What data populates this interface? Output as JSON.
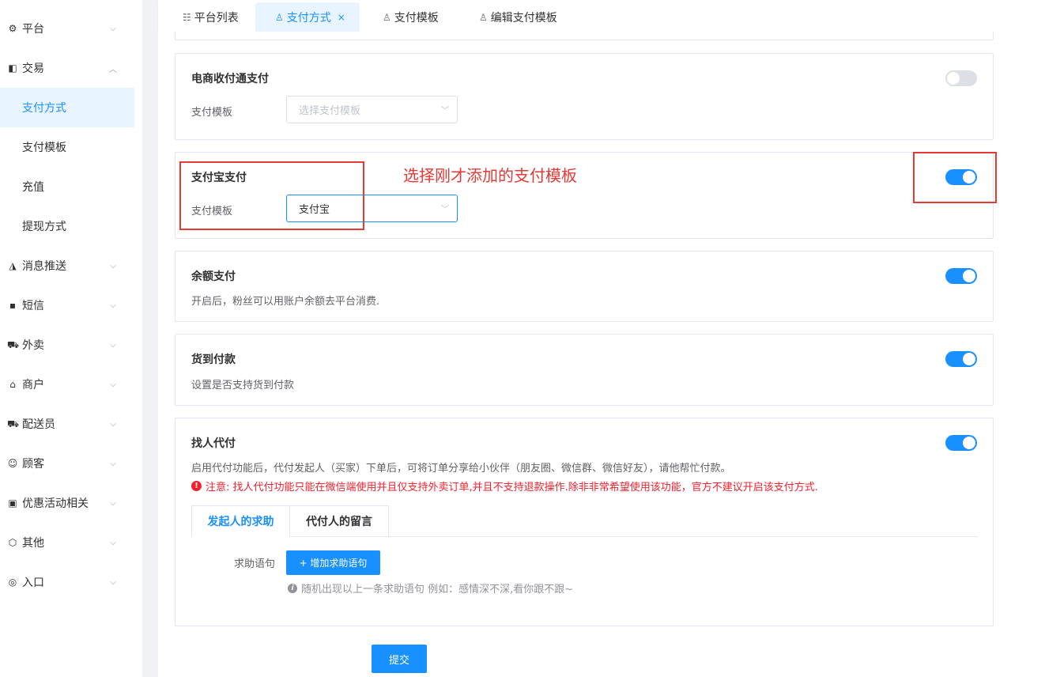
{
  "sidebar": {
    "items": [
      {
        "label": "平台",
        "icon": "gear-icon",
        "glyph": "⚙",
        "arrow": "⌵"
      },
      {
        "label": "交易",
        "icon": "wallet-icon",
        "glyph": "◧",
        "arrow": "︿"
      },
      {
        "label": "消息推送",
        "icon": "bell-icon",
        "glyph": "◮",
        "arrow": "⌵"
      },
      {
        "label": "短信",
        "icon": "message-icon",
        "glyph": "▪",
        "arrow": "⌵"
      },
      {
        "label": "外卖",
        "icon": "scooter-icon",
        "glyph": "⛟",
        "arrow": "⌵"
      },
      {
        "label": "商户",
        "icon": "shop-icon",
        "glyph": "⌂",
        "arrow": "⌵"
      },
      {
        "label": "配送员",
        "icon": "delivery-icon",
        "glyph": "⛟",
        "arrow": "⌵"
      },
      {
        "label": "顾客",
        "icon": "user-circle-icon",
        "glyph": "☺",
        "arrow": "⌵"
      },
      {
        "label": "优惠活动相关",
        "icon": "gift-icon",
        "glyph": "▣",
        "arrow": "⌵"
      },
      {
        "label": "其他",
        "icon": "hexagon-icon",
        "glyph": "⬡",
        "arrow": "⌵"
      },
      {
        "label": "入口",
        "icon": "compass-icon",
        "glyph": "◎",
        "arrow": "⌵"
      }
    ],
    "subitems": [
      {
        "label": "支付方式",
        "active": true
      },
      {
        "label": "支付模板",
        "active": false
      },
      {
        "label": "充值",
        "active": false
      },
      {
        "label": "提现方式",
        "active": false
      }
    ]
  },
  "tabs": [
    {
      "label": "平台列表",
      "icon": "list-icon",
      "glyph": "☷"
    },
    {
      "label": "支付方式",
      "icon": "user-icon",
      "glyph": "♙",
      "close": "×"
    },
    {
      "label": "支付模板",
      "icon": "user-icon",
      "glyph": "♙"
    },
    {
      "label": "编辑支付模板",
      "icon": "user-icon",
      "glyph": "♙"
    }
  ],
  "cards": {
    "ecommerce": {
      "title": "电商收付通支付",
      "label": "支付模板",
      "placeholder": "选择支付模板",
      "enabled": false
    },
    "alipay": {
      "title": "支付宝支付",
      "label": "支付模板",
      "value": "支付宝",
      "enabled": true
    },
    "balance": {
      "title": "余额支付",
      "desc": "开启后，粉丝可以用账户余额去平台消费.",
      "enabled": true
    },
    "cod": {
      "title": "货到付款",
      "desc": "设置是否支持货到付款",
      "enabled": true
    },
    "proxy": {
      "title": "找人代付",
      "desc": "启用代付功能后，代付发起人（买家）下单后，可将订单分享给小伙伴（朋友圈、微信群、微信好友），请他帮忙付款。",
      "warning": "注意:  找人代付功能只能在微信端使用并且仅支持外卖订单,并且不支持退款操作.除非非常希望使用该功能，官方不建议开启该支付方式.",
      "enabled": true,
      "tabs": [
        "发起人的求助",
        "代付人的留言"
      ],
      "field_label": "求助语句",
      "add_button": "+ 增加求助语句",
      "hint": "随机出现以上一条求助语句 例如：感情深不深,看你跟不跟~"
    }
  },
  "annotation": "选择刚才添加的支付模板",
  "submit_label": "提交",
  "colors": {
    "primary": "#1890ff",
    "annotation": "#e53935",
    "warning": "#f5222d"
  }
}
